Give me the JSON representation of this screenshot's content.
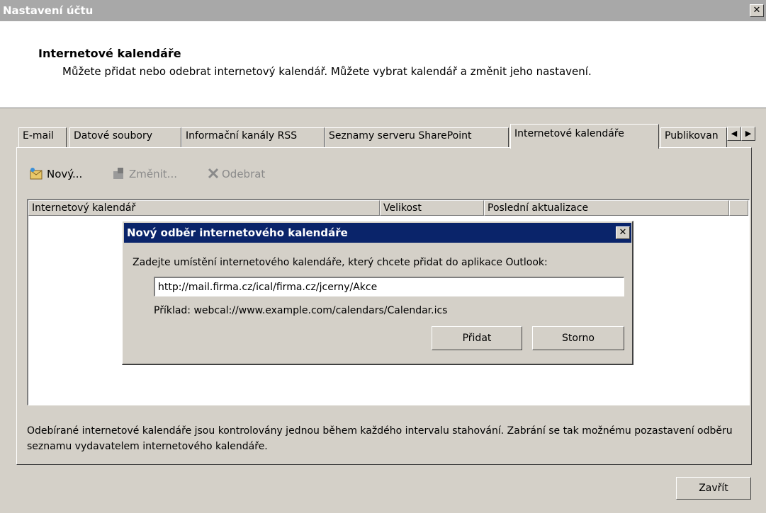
{
  "window": {
    "title": "Nastavení účtu",
    "close_label": "✕"
  },
  "header": {
    "heading": "Internetové kalendáře",
    "description": "Můžete přidat nebo odebrat internetový kalendář. Můžete vybrat kalendář a změnit jeho nastavení."
  },
  "tabs": [
    {
      "label": "E-mail"
    },
    {
      "label": "Datové soubory"
    },
    {
      "label": "Informační kanály RSS"
    },
    {
      "label": "Seznamy serveru SharePoint"
    },
    {
      "label": "Internetové kalendáře"
    },
    {
      "label": "Publikovan"
    }
  ],
  "tab_scroll": {
    "left": "◀",
    "right": "▶"
  },
  "toolbar": {
    "new_label": "Nový...",
    "change_label": "Změnit...",
    "remove_label": "Odebrat"
  },
  "list": {
    "columns": [
      "Internetový kalendář",
      "Velikost",
      "Poslední aktualizace"
    ],
    "rows": []
  },
  "footer_note": "Odebírané internetové kalendáře jsou kontrolovány jednou během každého intervalu stahování. Zabrání se tak možnému pozastavení odběru seznamu vydavatelem internetového kalendáře.",
  "close_button": "Zavřít",
  "dialog": {
    "title": "Nový odběr internetového kalendáře",
    "close_label": "✕",
    "prompt": "Zadejte umístění internetového kalendáře, který chcete přidat do aplikace Outlook:",
    "url_value": "http://mail.firma.cz/ical/firma.cz/jcerny/Akce",
    "example": "Příklad: webcal://www.example.com/calendars/Calendar.ics",
    "add_button": "Přidat",
    "cancel_button": "Storno"
  },
  "colors": {
    "title_inactive": "#a8a8a8",
    "dialog_title": "#0a246a",
    "face": "#d4d0c8"
  }
}
